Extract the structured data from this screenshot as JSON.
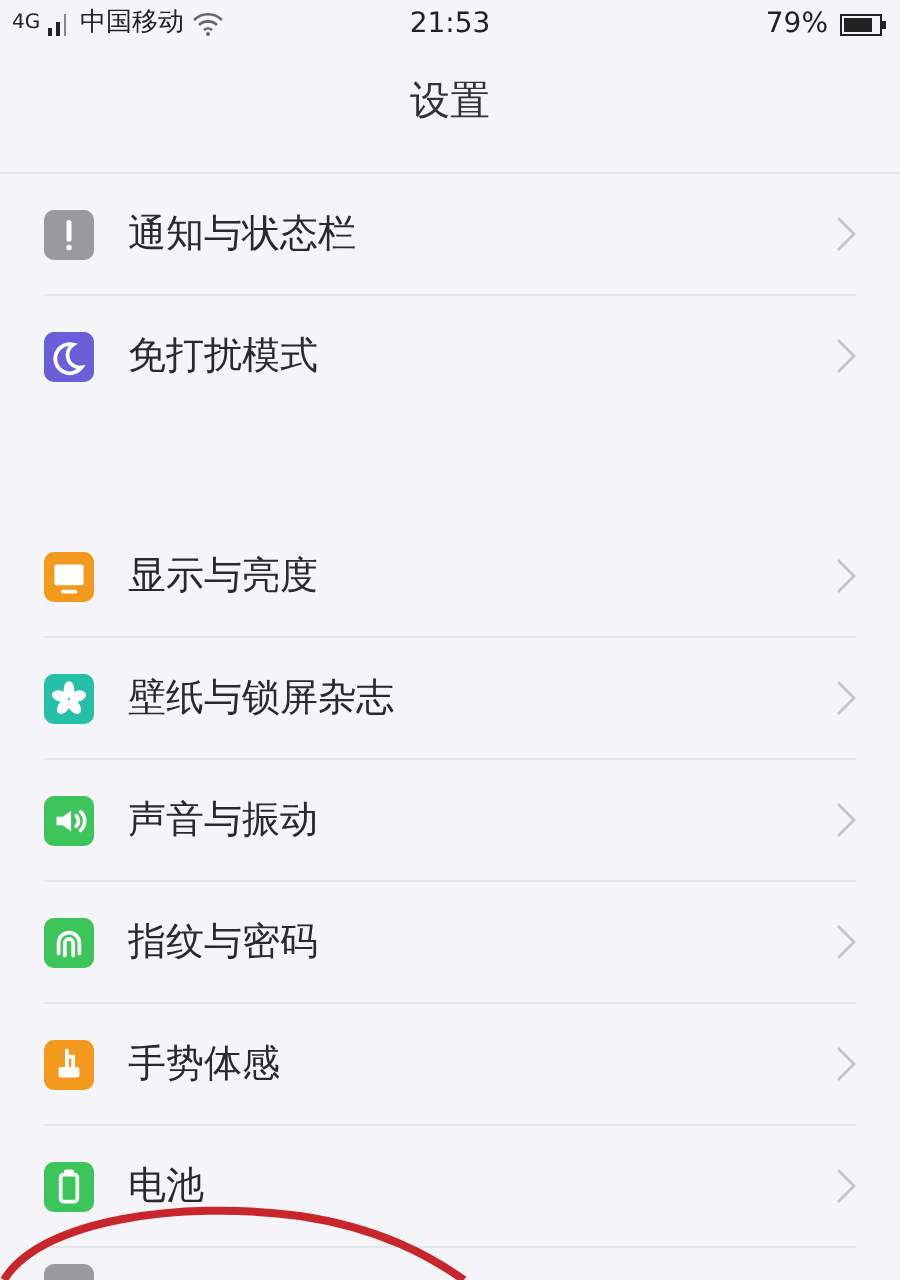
{
  "status_bar": {
    "network": "4G",
    "carrier": "中国移动",
    "time": "21:53",
    "battery": "79%"
  },
  "title": "设置",
  "groups": [
    {
      "items": [
        {
          "label": "通知与状态栏",
          "kind": "alert",
          "color": "#9a9a9e"
        },
        {
          "label": "免打扰模式",
          "kind": "moon",
          "color": "#6b5fd9"
        }
      ]
    },
    {
      "items": [
        {
          "label": "显示与亮度",
          "kind": "display",
          "color": "#f39a1e"
        },
        {
          "label": "壁纸与锁屏杂志",
          "kind": "flower",
          "color": "#26c0a8"
        },
        {
          "label": "声音与振动",
          "kind": "speaker",
          "color": "#3dc45a"
        },
        {
          "label": "指纹与密码",
          "kind": "fingerprint",
          "color": "#3dc45a"
        },
        {
          "label": "手势体感",
          "kind": "hand",
          "color": "#f39a1e"
        },
        {
          "label": "电池",
          "kind": "battery",
          "color": "#3dc45a"
        },
        {
          "kind": "partial",
          "color": "#9a9a9e"
        }
      ]
    }
  ]
}
